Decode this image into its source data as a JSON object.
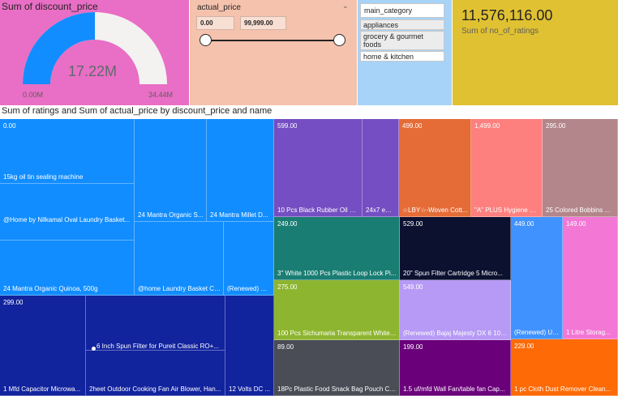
{
  "gauge": {
    "title": "Sum of discount_price",
    "value": "17.22M",
    "min": "0.00M",
    "max": "34.44M",
    "fraction": 0.5,
    "bg": "#e96ec5",
    "fill": "#118dff",
    "track": "#f3f2f1"
  },
  "slicer": {
    "title": "actual_price",
    "min_value": "0.00",
    "max_value": "99,999.00",
    "bg": "#f4c2ad"
  },
  "category": {
    "title": "main_category",
    "items": [
      "appliances",
      "grocery & gourmet foods",
      "home & kitchen"
    ],
    "bg": "#a6d3f7"
  },
  "card": {
    "value": "11,576,116.00",
    "label": "Sum of no_of_ratings",
    "bg": "#e0c131"
  },
  "treemap_title": "Sum of ratings and Sum of actual_price by discount_price and name",
  "treemap": {
    "c0": {
      "value": "0.00",
      "label": "15kg oil tin sealing machine"
    },
    "c1": {
      "label": "@Home by Nilkamal Oval Laundry Basket..."
    },
    "c2": {
      "label": "24 Mantra Organic Quinoa, 500g"
    },
    "c3": {
      "label": "24 Mantra Organic S..."
    },
    "c4": {
      "label": "24 Mantra Millet D..."
    },
    "c5": {
      "label": "@home Laundry Basket Cl..."
    },
    "c6": {
      "label": "(Renewed) Cr..."
    },
    "c7": {
      "value": "299.00",
      "label": "1 Mfd Capacitor Microwa..."
    },
    "c8": {
      "label": "6 Inch Spun Filter for Pureit Classic RO+..."
    },
    "c9": {
      "label": "2heet Outdoor Cooking Fan Air Blower, Han..."
    },
    "c10": {
      "label": "12 Volts DC ..."
    },
    "c11": {
      "value": "599.00",
      "label": "10 Pcs Black Rubber Oil Se..."
    },
    "c12": {
      "label": "24x7 eM..."
    },
    "c13": {
      "value": "499.00",
      "label": "☆LBY☆-Woven Cott..."
    },
    "c14": {
      "value": "1,499.00",
      "label": "\"A\" PLUS Hygiene Po..."
    },
    "c15": {
      "value": "295.00",
      "label": "25 Colored Bobbins ..."
    },
    "c16": {
      "value": "249.00",
      "label": "3\" White 1000 Pcs Plastic Loop Lock Pi..."
    },
    "c17": {
      "value": "529.00",
      "label": "20\" Spun Filter Cartridge 5 Micro..."
    },
    "c18": {
      "value": "449.00",
      "label": "(Renewed) Us..."
    },
    "c19": {
      "value": "149.00",
      "label": "1 Litre Storag..."
    },
    "c20": {
      "value": "275.00",
      "label": "100 Pcs Sichumaria Transparent White ..."
    },
    "c21": {
      "value": "549.00",
      "label": "(Renewed) Bajaj Majesty DX 6 100..."
    },
    "c22": {
      "value": "89.00",
      "label": "18Pc Plastic Food Snack Bag Pouch Clip..."
    },
    "c23": {
      "value": "199.00",
      "label": "1.5 uf/mfd Wall Fan/table fan Cap..."
    },
    "c24": {
      "value": "229.00",
      "label": "1 pc Cloth Dust Remover Clean..."
    }
  }
}
